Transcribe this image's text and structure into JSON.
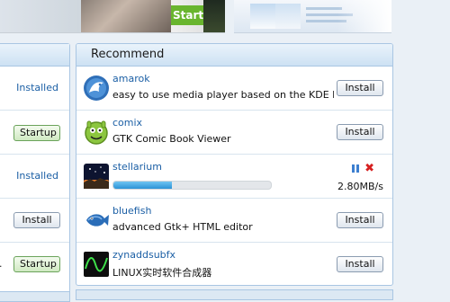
{
  "banner": {
    "start_label": "Start"
  },
  "left_list": {
    "rows": [
      {
        "kind": "text",
        "label": "Installed"
      },
      {
        "kind": "button",
        "label": "Startup"
      },
      {
        "kind": "text",
        "label": "Installed"
      },
      {
        "kind": "button",
        "label": "Install"
      },
      {
        "kind": "button",
        "label": "Startup",
        "prefix": "."
      }
    ]
  },
  "recommend": {
    "title": "Recommend",
    "items": [
      {
        "name": "amarok",
        "description": "easy to use media player based on the KDE Pl…",
        "button": "Install",
        "icon": "amarok-wolf-icon"
      },
      {
        "name": "comix",
        "description": "GTK Comic Book Viewer",
        "button": "Install",
        "icon": "comix-face-icon"
      },
      {
        "name": "stellarium",
        "progress": 0.37,
        "speed": "2.80MB/s",
        "icon": "stellarium-sky-icon"
      },
      {
        "name": "bluefish",
        "description": "advanced Gtk+ HTML editor",
        "button": "Install",
        "icon": "bluefish-fish-icon"
      },
      {
        "name": "zynaddsubfx",
        "description": "LINUX实时软件合成器",
        "button": "Install",
        "icon": "zynaddsubfx-wave-icon"
      }
    ]
  },
  "colors": {
    "link": "#1b5fa5",
    "panel_border": "#a9c6e3",
    "progress": "#2c93d6",
    "cancel": "#d62020"
  }
}
